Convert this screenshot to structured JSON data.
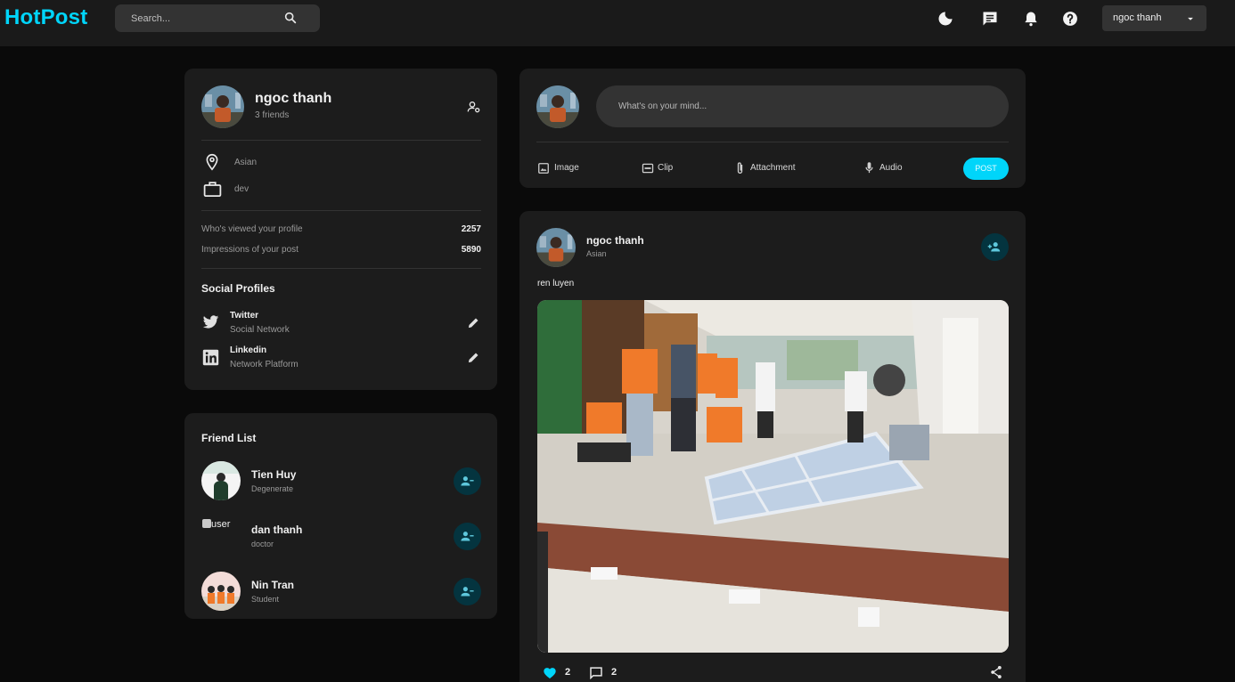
{
  "app": {
    "logo": "HotPost"
  },
  "topbar": {
    "search_placeholder": "Search...",
    "icons": [
      "search-icon",
      "dark-mode-icon",
      "message-icon",
      "bell-icon",
      "help-icon",
      "caret-down-icon"
    ],
    "user_name": "ngoc thanh"
  },
  "profile": {
    "name": "ngoc thanh",
    "friends": "3 friends",
    "location": "Asian",
    "occupation": "dev",
    "stats": [
      {
        "label": "Who's viewed your profile",
        "value": "2257"
      },
      {
        "label": "Impressions of your post",
        "value": "5890"
      }
    ],
    "social_title": "Social Profiles",
    "social": [
      {
        "name": "Twitter",
        "sub": "Social Network"
      },
      {
        "name": "Linkedin",
        "sub": "Network Platform"
      }
    ]
  },
  "friends": {
    "title": "Friend List",
    "items": [
      {
        "name": "Tien Huy",
        "sub": "Degenerate"
      },
      {
        "name": "dan thanh",
        "sub": "doctor",
        "alt": "user"
      },
      {
        "name": "Nin Tran",
        "sub": "Student"
      }
    ]
  },
  "composer": {
    "placeholder": "What's on your mind...",
    "actions": [
      "Image",
      "Clip",
      "Attachment",
      "Audio"
    ],
    "post_label": "POST"
  },
  "post": {
    "author": "ngoc thanh",
    "location": "Asian",
    "caption": "ren luyen",
    "likes": "2",
    "comments": "2"
  },
  "colors": {
    "accent": "#00d5fa",
    "card": "#1c1c1c",
    "background": "#0a0a0a",
    "topbar": "#1a1a1a"
  }
}
